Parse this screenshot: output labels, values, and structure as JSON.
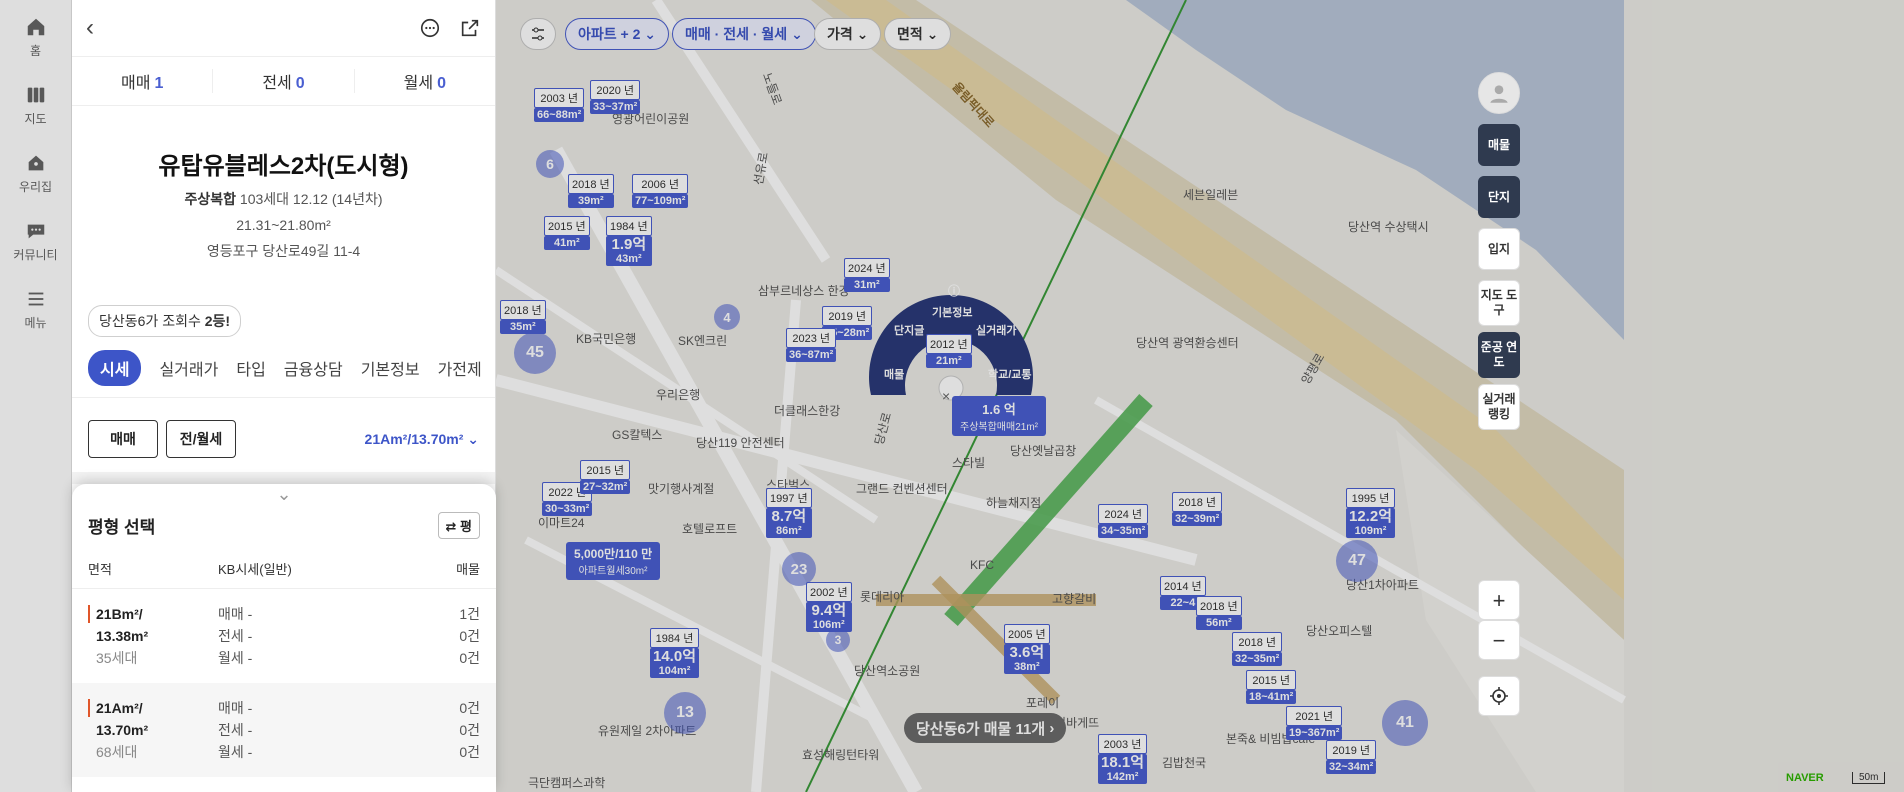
{
  "nav": {
    "items": [
      {
        "label": "홈",
        "icon": "home-icon"
      },
      {
        "label": "지도",
        "icon": "map-icon"
      },
      {
        "label": "우리집",
        "icon": "my-home-icon"
      },
      {
        "label": "커뮤니티",
        "icon": "community-icon"
      },
      {
        "label": "메뉴",
        "icon": "menu-icon"
      }
    ]
  },
  "panel": {
    "deal_tabs": [
      {
        "label": "매매",
        "count": "1"
      },
      {
        "label": "전세",
        "count": "0"
      },
      {
        "label": "월세",
        "count": "0"
      }
    ],
    "complex": {
      "name": "유탑유블레스2차(도시형)",
      "type_label": "주상복합",
      "meta": "103세대 12.12 (14년차)",
      "area": "21.31~21.80m²",
      "address": "영등포구 당산로49길 11-4"
    },
    "views_badge": {
      "prefix": "당산동6가 조회수 ",
      "rank": "2등!"
    },
    "subtabs": [
      "시세",
      "실거래가",
      "타입",
      "금융상담",
      "기본정보",
      "가전제"
    ],
    "buttons": {
      "sale": "매매",
      "rent": "전/월세"
    },
    "area_select": "21Am²/13.70m²",
    "section_title": "시세",
    "pyeong_label": "평"
  },
  "sheet": {
    "title": "평형 선택",
    "pyeong_label": "평",
    "headers": {
      "area": "면적",
      "kb": "KB시세(일반)",
      "listings": "매물"
    },
    "rows": [
      {
        "area1": "21Bm²/",
        "area2": "13.38m²",
        "households": "35세대",
        "sale": "매매 -",
        "jeonse": "전세 -",
        "monthly": "월세 -",
        "c_sale": "1건",
        "c_jeonse": "0건",
        "c_monthly": "0건"
      },
      {
        "area1": "21Am²/",
        "area2": "13.70m²",
        "households": "68세대",
        "sale": "매매 -",
        "jeonse": "전세 -",
        "monthly": "월세 -",
        "c_sale": "0건",
        "c_jeonse": "0건",
        "c_monthly": "0건"
      }
    ]
  },
  "map": {
    "filters": [
      "아파트 + 2",
      "매매 · 전세 · 월세",
      "가격",
      "면적"
    ],
    "right_buttons": [
      "매물",
      "단지",
      "입지",
      "지도 도구",
      "준공 연도",
      "실거래 랭킹"
    ],
    "listing_banner": "당산동6가 매물 11개",
    "radial_menu": [
      "기본정보",
      "단지글",
      "실거래가",
      "매물",
      "학교/교통"
    ],
    "selected_marker": {
      "year": "2012 년",
      "area": "21m²"
    },
    "selected_tooltip": {
      "price": "1.6 억",
      "desc": "주상복합매매21m²"
    },
    "rent_marker": {
      "price": "5,000만/110 만",
      "desc": "아파트월세30m²"
    },
    "markers": [
      {
        "year": "2020 년",
        "area": "33~37m²"
      },
      {
        "year": "2003 년",
        "area": "66~88m²"
      },
      {
        "year": "2018 년",
        "area": "39m²"
      },
      {
        "year": "2006 년",
        "area": "77~109m²"
      },
      {
        "year": "2015 년",
        "area": "41m²"
      },
      {
        "year": "1984 년",
        "price": "1.9억",
        "area": "43m²"
      },
      {
        "year": "2024 년",
        "area": "31m²"
      },
      {
        "year": "2019 년",
        "area": "25~28m²"
      },
      {
        "year": "2023 년",
        "area": "36~87m²"
      },
      {
        "year": "1997 년",
        "price": "8.7억",
        "area": "86m²"
      },
      {
        "year": "2002 년",
        "price": "9.4억",
        "area": "106m²"
      },
      {
        "year": "1984 년",
        "price": "14.0억",
        "area": "104m²"
      },
      {
        "year": "2005 년",
        "price": "3.6억",
        "area": "38m²"
      },
      {
        "year": "2003 년",
        "price": "18.1억",
        "area": "142m²"
      },
      {
        "year": "1995 년",
        "price": "12.2억",
        "area": "109m²"
      },
      {
        "year": "2024 년",
        "area": "34~35m²"
      },
      {
        "year": "2018 년",
        "area": "32~39m²"
      },
      {
        "year": "2014 년",
        "area": "22~4"
      },
      {
        "year": "2018 년",
        "area": "56m²"
      },
      {
        "year": "2018 년",
        "area": "32~35m²"
      },
      {
        "year": "2015 년",
        "area": "18~41m²"
      },
      {
        "year": "2021 년",
        "area": "19~367m²"
      },
      {
        "year": "2019 년",
        "area": "32~34m²"
      },
      {
        "year": "2022 년",
        "area": "30~33m²"
      },
      {
        "year": "2015 년",
        "area": "27~32m²"
      },
      {
        "year": "2018 년",
        "area": "35m²"
      }
    ],
    "clusters": [
      "45",
      "23",
      "13",
      "3",
      "41",
      "47",
      "6",
      "4"
    ],
    "places": [
      "영광어린이공원",
      "세븐일레븐",
      "당산역 수상택시",
      "삼부르네상스 한강",
      "KB국민은행",
      "SK엔크린",
      "우리은행",
      "GS칼텍스",
      "당산역 광역환승센터",
      "더클래스한강",
      "당산119 안전센터",
      "맛기행사계절",
      "호텔로프트",
      "스타벅스",
      "그랜드 컨벤션센터",
      "하늘채지점",
      "당산옛날곱창",
      "스타빌",
      "이마트24",
      "고향갈비",
      "유원제일 2차아파트",
      "효성해링턴타워",
      "당산역소공원",
      "롯데리아",
      "파리바게뜨",
      "김밥천국",
      "본죽& 비빔밥cafe",
      "포레이",
      "KFC",
      "당산1차아파트",
      "당산오피스텔",
      "극단캠퍼스과학",
      "올림픽대로",
      "노들로",
      "선유로",
      "당산로",
      "양평로"
    ],
    "naver_logo": "NAVER",
    "scale": "50m"
  }
}
